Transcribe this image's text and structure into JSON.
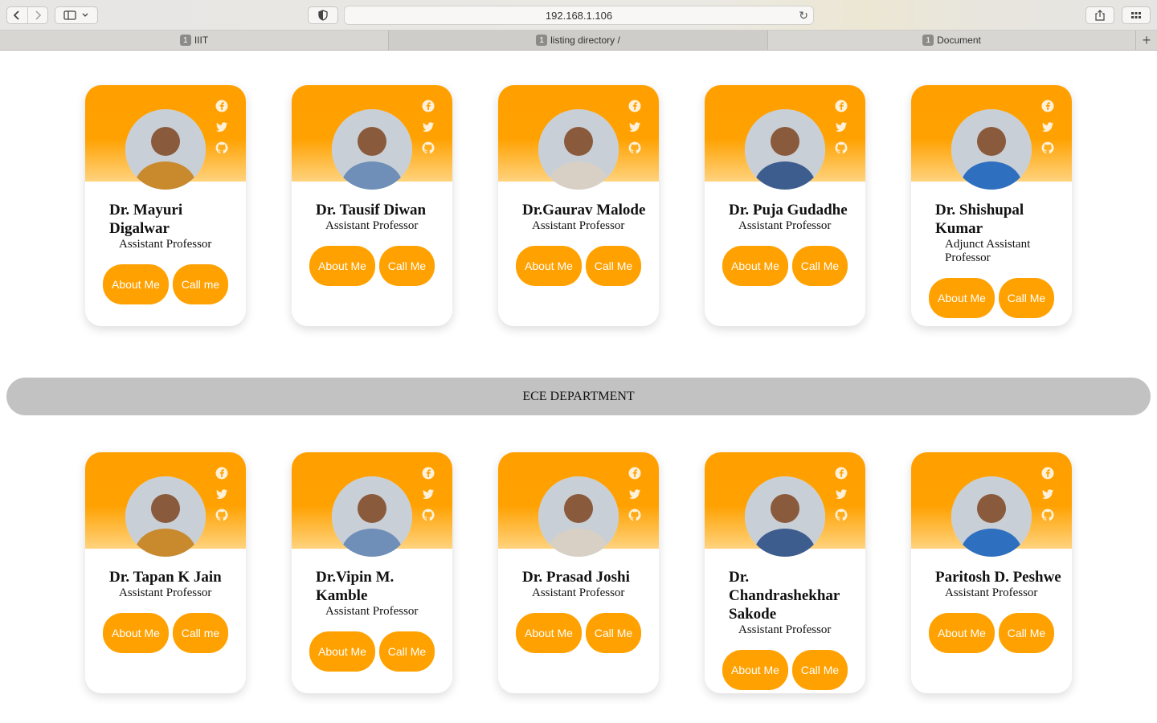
{
  "browser": {
    "url": "192.168.1.106",
    "tabs": [
      {
        "badge": "1",
        "label": "IIIT"
      },
      {
        "badge": "1",
        "label": "listing directory /"
      },
      {
        "badge": "1",
        "label": "Document"
      }
    ]
  },
  "colors": {
    "accent": "#ffa100",
    "banner": "#c2c2c2"
  },
  "sections": {
    "faculty_top": [
      {
        "name": "Dr. Mayuri Digalwar",
        "title": "Assistant Professor",
        "about": "About Me",
        "call": "Call me"
      },
      {
        "name": "Dr. Tausif Diwan",
        "title": "Assistant Professor",
        "about": "About Me",
        "call": "Call Me"
      },
      {
        "name": "Dr.Gaurav Malode",
        "title": "Assistant Professor",
        "about": "About Me",
        "call": "Call Me"
      },
      {
        "name": "Dr. Puja Gudadhe",
        "title": "Assistant Professor",
        "about": "About Me",
        "call": "Call Me"
      },
      {
        "name": "Dr. Shishupal Kumar",
        "title": "Adjunct Assistant Professor",
        "about": "About Me",
        "call": "Call Me"
      }
    ],
    "ece_heading": "ECE DEPARTMENT",
    "faculty_ece": [
      {
        "name": "Dr. Tapan K Jain",
        "title": "Assistant Professor",
        "about": "About Me",
        "call": "Call me"
      },
      {
        "name": "Dr.Vipin M. Kamble",
        "title": "Assistant Professor",
        "about": "About Me",
        "call": "Call Me"
      },
      {
        "name": "Dr. Prasad Joshi",
        "title": "Assistant Professor",
        "about": "About Me",
        "call": "Call Me"
      },
      {
        "name": "Dr. Chandrashekhar Sakode",
        "title": "Assistant Professor",
        "about": "About Me",
        "call": "Call Me"
      },
      {
        "name": "Paritosh D. Peshwe",
        "title": "Assistant Professor",
        "about": "About Me",
        "call": "Call Me"
      }
    ]
  },
  "social_icons": [
    "facebook-icon",
    "twitter-icon",
    "github-icon"
  ]
}
